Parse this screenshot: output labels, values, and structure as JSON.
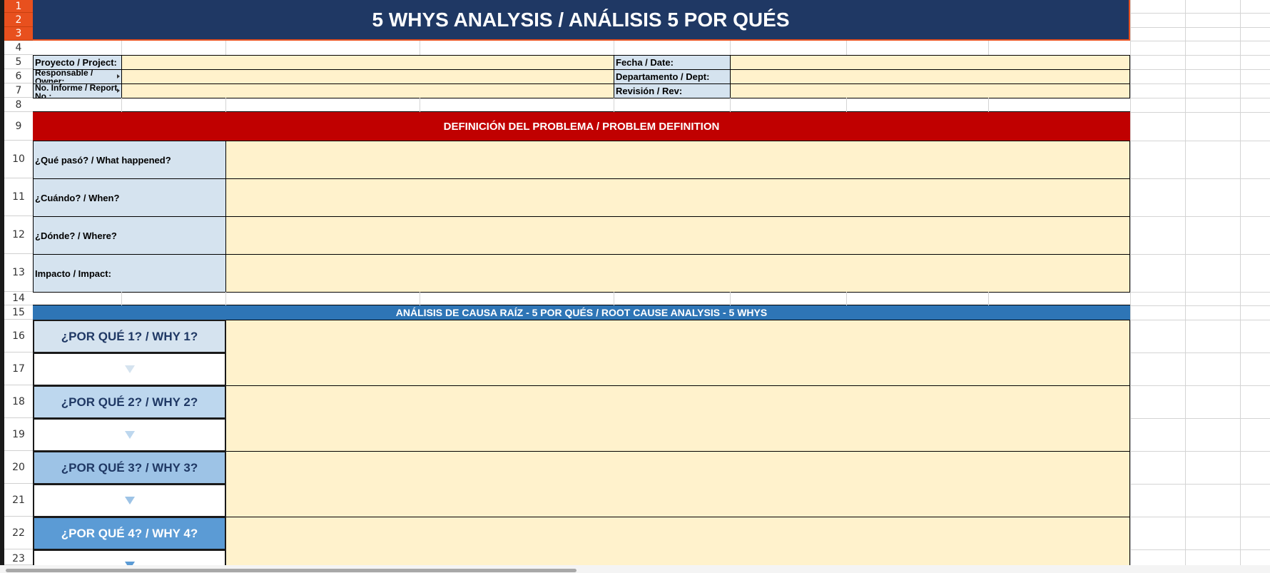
{
  "spreadsheet": {
    "row_numbers": [
      "1",
      "2",
      "3",
      "4",
      "5",
      "6",
      "7",
      "8",
      "9",
      "10",
      "11",
      "12",
      "13",
      "14",
      "15",
      "16",
      "17",
      "18",
      "19",
      "20",
      "21",
      "22",
      "23"
    ],
    "title": "5 WHYS ANALYSIS / ANÁLISIS 5 POR QUÉS",
    "header_info": {
      "project_label": "Proyecto / Project:",
      "owner_label": "Responsable / Owner:",
      "report_label": "No. Informe / Report No.:",
      "date_label": "Fecha / Date:",
      "dept_label": "Departamento / Dept:",
      "rev_label": "Revisión / Rev:"
    },
    "problem_section": {
      "title": "DEFINICIÓN DEL PROBLEMA / PROBLEM DEFINITION",
      "what_label": "¿Qué pasó? / What happened?",
      "when_label": "¿Cuándo? / When?",
      "where_label": "¿Dónde? / Where?",
      "impact_label": "Impacto / Impact:"
    },
    "rca_section": {
      "title": "ANÁLISIS DE CAUSA RAÍZ - 5 POR QUÉS / ROOT CAUSE ANALYSIS - 5 WHYS",
      "why1": "¿POR QUÉ 1? / WHY 1?",
      "why2": "¿POR QUÉ 2? / WHY 2?",
      "why3": "¿POR QUÉ 3? / WHY 3?",
      "why4": "¿POR QUÉ 4? / WHY 4?",
      "arrow": "▼"
    },
    "colors": {
      "title_bg": "#1f3864",
      "problem_bg": "#c00000",
      "rca_bg": "#2e75b6",
      "input_bg": "#fff2cc",
      "label_bg": "#d5e3ef",
      "why1_bg": "#d5e3ef",
      "why2_bg": "#bdd7ee",
      "why3_bg": "#9dc3e6",
      "why4_bg": "#5b9bd5"
    }
  }
}
